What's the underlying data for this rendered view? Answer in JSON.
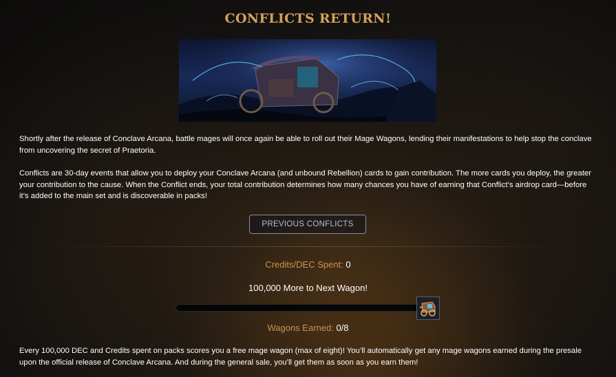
{
  "header": {
    "title": "CONFLICTS RETURN!"
  },
  "banner": {
    "icon": "mage-wagon-night-scene"
  },
  "intro": {
    "paragraph1": "Shortly after the release of Conclave Arcana, battle mages will once again be able to roll out their Mage Wagons, lending their manifestations to help stop the conclave from uncovering the secret of Praetoria.",
    "paragraph2": "Conflicts are 30-day events that allow you to deploy your Conclave Arcana (and unbound Rebellion) cards to gain contribution. The more cards you deploy, the greater your contribution to the cause. When the Conflict ends, your total contribution determines how many chances you have of earning that Conflict’s airdrop card—before it’s added to the main set and is discoverable in packs!"
  },
  "buttons": {
    "previous_conflicts": "PREVIOUS CONFLICTS"
  },
  "progress": {
    "credits_label": "Credits/DEC Spent:",
    "credits_value": "0",
    "next_wagon_text": "100,000 More to Next Wagon!",
    "progress_fraction": 0,
    "wagon_icon": "mage-wagon-icon",
    "wagons_label": "Wagons Earned:",
    "wagons_value": "0/8"
  },
  "footer": {
    "paragraph": "Every 100,000 DEC and Credits spent on packs scores you a free mage wagon (max of eight)! You’ll automatically get any mage wagons earned during the presale upon the official release of Conclave Arcana. And during the general sale, you’ll get them as soon as you earn them!"
  },
  "colors": {
    "accent_gold": "#d5a15a",
    "label_gold": "#c99550",
    "button_text": "#b8bed8"
  }
}
